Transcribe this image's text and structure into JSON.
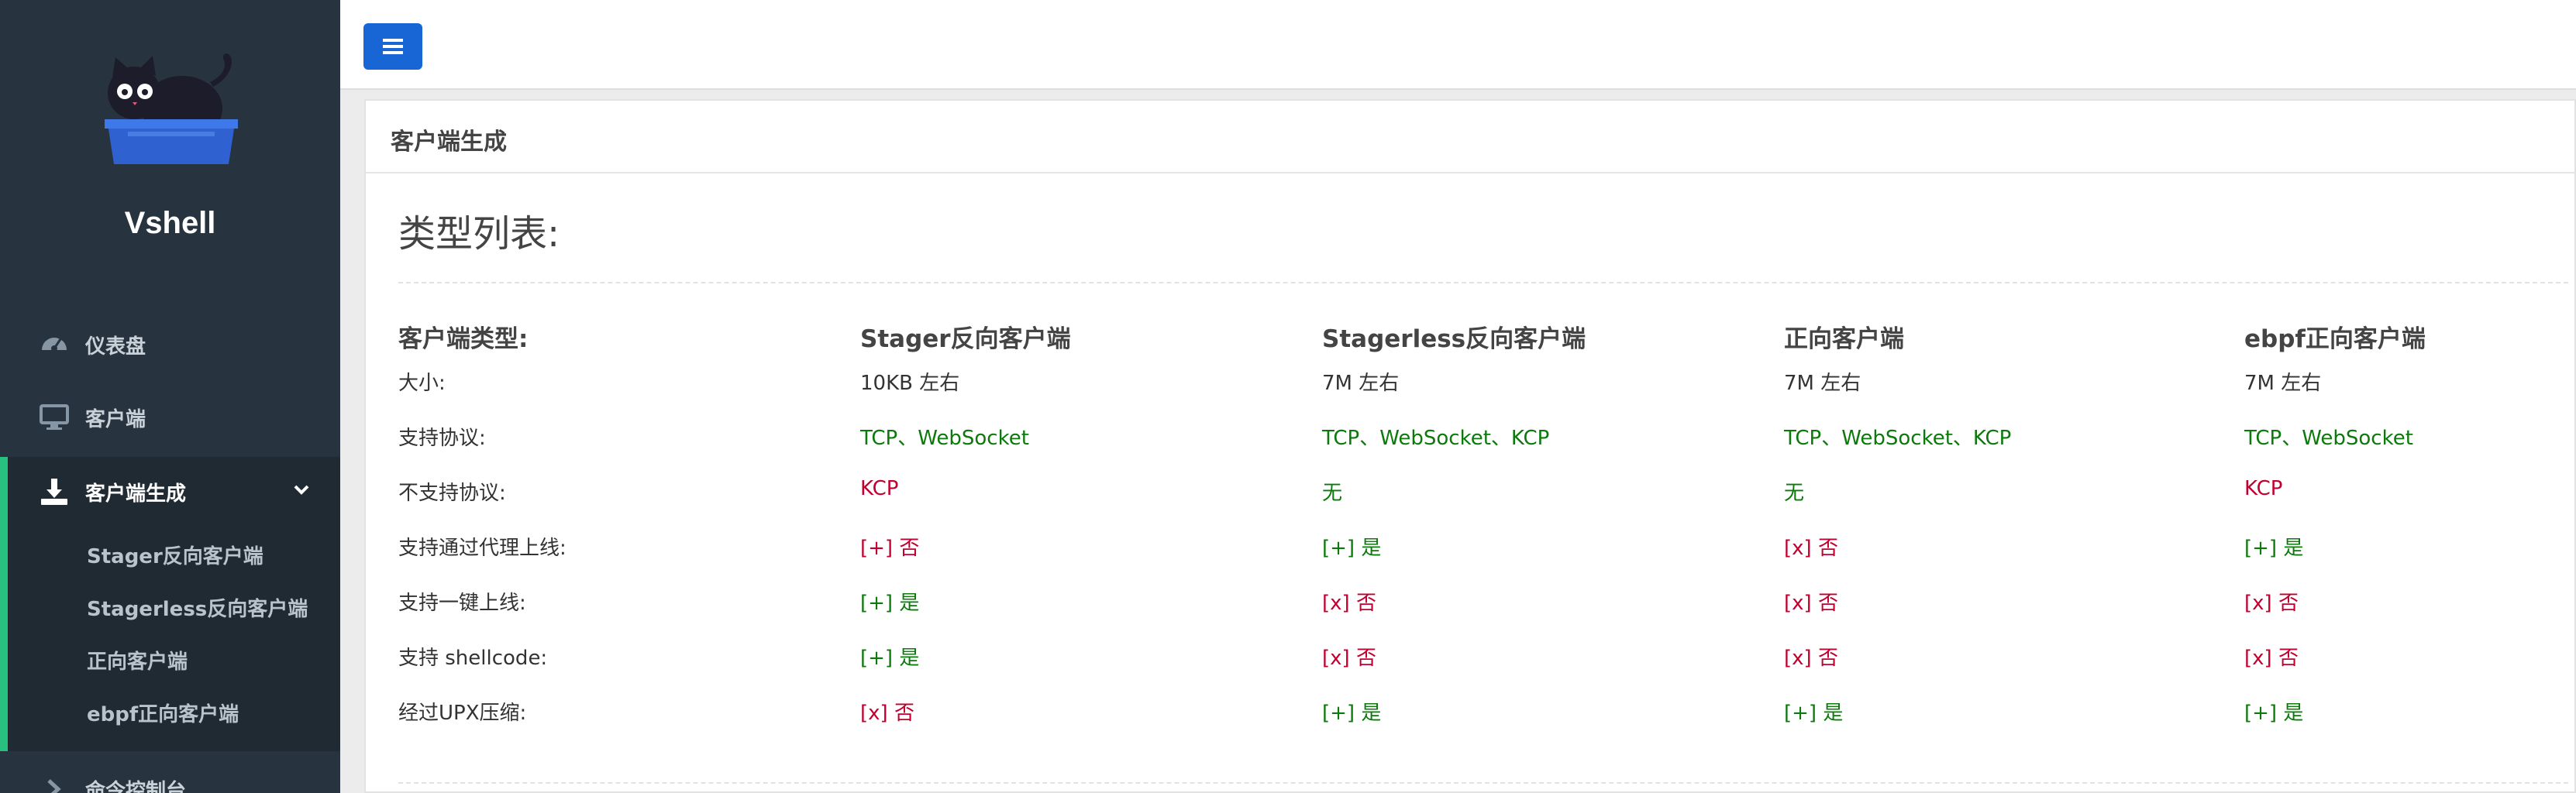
{
  "app": {
    "name": "Vshell"
  },
  "sidebar": {
    "items": [
      {
        "label": "仪表盘",
        "icon": "dashboard-icon"
      },
      {
        "label": "客户端",
        "icon": "monitor-icon"
      },
      {
        "label": "客户端生成",
        "icon": "download-icon"
      },
      {
        "label": "命令控制台",
        "icon": "chevron-right-icon"
      }
    ],
    "subitems": [
      {
        "label": "Stager反向客户端"
      },
      {
        "label": "Stagerless反向客户端"
      },
      {
        "label": "正向客户端"
      },
      {
        "label": "ebpf正向客户端"
      }
    ]
  },
  "panel": {
    "title": "客户端生成",
    "section_title": "类型列表:"
  },
  "table": {
    "headers": [
      "客户端类型:",
      "Stager反向客户端",
      "Stagerless反向客户端",
      "正向客户端",
      "ebpf正向客户端"
    ],
    "rows": [
      {
        "label": "大小:",
        "cells": [
          {
            "text": "10KB 左右",
            "status": "neutral"
          },
          {
            "text": "7M 左右",
            "status": "neutral"
          },
          {
            "text": "7M 左右",
            "status": "neutral"
          },
          {
            "text": "7M 左右",
            "status": "neutral"
          }
        ]
      },
      {
        "label": "支持协议:",
        "cells": [
          {
            "text": "TCP、WebSocket",
            "status": "ok"
          },
          {
            "text": "TCP、WebSocket、KCP",
            "status": "ok"
          },
          {
            "text": "TCP、WebSocket、KCP",
            "status": "ok"
          },
          {
            "text": "TCP、WebSocket",
            "status": "ok"
          }
        ]
      },
      {
        "label": "不支持协议:",
        "cells": [
          {
            "text": "KCP",
            "status": "bad"
          },
          {
            "text": "无",
            "status": "ok"
          },
          {
            "text": "无",
            "status": "ok"
          },
          {
            "text": "KCP",
            "status": "bad"
          }
        ]
      },
      {
        "label": "支持通过代理上线:",
        "cells": [
          {
            "text": "[+] 否",
            "status": "bad"
          },
          {
            "text": "[+] 是",
            "status": "ok"
          },
          {
            "text": "[x] 否",
            "status": "bad"
          },
          {
            "text": "[+] 是",
            "status": "ok"
          }
        ]
      },
      {
        "label": "支持一键上线:",
        "cells": [
          {
            "text": "[+] 是",
            "status": "ok"
          },
          {
            "text": "[x] 否",
            "status": "bad"
          },
          {
            "text": "[x] 否",
            "status": "bad"
          },
          {
            "text": "[x] 否",
            "status": "bad"
          }
        ]
      },
      {
        "label": "支持 shellcode:",
        "cells": [
          {
            "text": "[+] 是",
            "status": "ok"
          },
          {
            "text": "[x] 否",
            "status": "bad"
          },
          {
            "text": "[x] 否",
            "status": "bad"
          },
          {
            "text": "[x] 否",
            "status": "bad"
          }
        ]
      },
      {
        "label": "经过UPX压缩:",
        "cells": [
          {
            "text": "[x] 否",
            "status": "bad"
          },
          {
            "text": "[+] 是",
            "status": "ok"
          },
          {
            "text": "[+] 是",
            "status": "ok"
          },
          {
            "text": "[+] 是",
            "status": "ok"
          }
        ]
      }
    ]
  },
  "colors": {
    "accent": "#1866d6",
    "sidebar_bg": "#27333e",
    "active_bar": "#27c07f",
    "ok": "#0b7a0b",
    "bad": "#c2002f"
  }
}
